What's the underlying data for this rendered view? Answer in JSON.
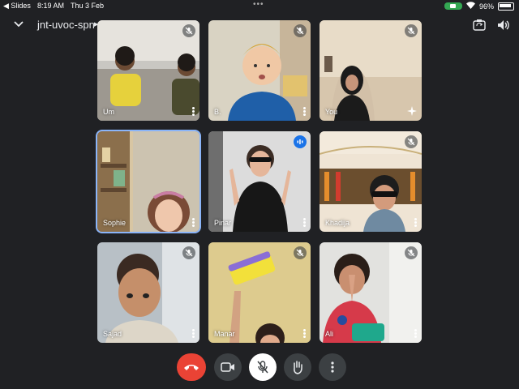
{
  "status_bar": {
    "back_app": "◀ Slides",
    "time": "8:19 AM",
    "date": "Thu 3 Feb",
    "battery": "96%"
  },
  "meeting": {
    "code": "jnt-uvoc-spn"
  },
  "participants": [
    {
      "name": "Um",
      "muted": true
    },
    {
      "name": "B.",
      "muted": true
    },
    {
      "name": "You",
      "muted": true
    },
    {
      "name": "Sophie",
      "muted": false,
      "active": true
    },
    {
      "name": "Pinar",
      "muted": false,
      "speaking": true
    },
    {
      "name": "Khadija",
      "muted": true
    },
    {
      "name": "Sajad",
      "muted": true
    },
    {
      "name": "Manar",
      "muted": true
    },
    {
      "name": "Ali",
      "muted": true
    }
  ],
  "colors": {
    "background": "#202124",
    "end_call": "#ea4335",
    "active_border": "#8ab4f8",
    "speaking": "#1a73e8",
    "battery": "#34a853"
  },
  "controls": [
    "end-call-icon",
    "camera-icon",
    "mic-off-icon",
    "raise-hand-icon",
    "more-options-icon"
  ]
}
